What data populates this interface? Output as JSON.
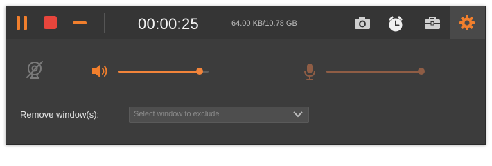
{
  "toolbar": {
    "timer": "00:00:25",
    "file_size": "64.00 KB/10.78 GB",
    "icons": {
      "pause": "pause-icon",
      "stop": "stop-icon",
      "minimize": "minimize-icon",
      "screenshot": "camera-icon",
      "schedule": "alarm-clock-icon",
      "toolbox": "toolbox-icon",
      "settings": "gear-icon"
    }
  },
  "audio": {
    "webcam_icon": "webcam-off-icon",
    "system_sound": {
      "icon": "speaker-icon",
      "level": 0.9
    },
    "microphone": {
      "icon": "microphone-icon",
      "level": 1.0
    }
  },
  "exclude": {
    "label": "Remove window(s):",
    "placeholder": "Select window to exclude"
  },
  "colors": {
    "accent": "#f17f2d",
    "stop": "#e8453c",
    "mic": "#8f5d45",
    "panel": "#3c3c3c"
  }
}
